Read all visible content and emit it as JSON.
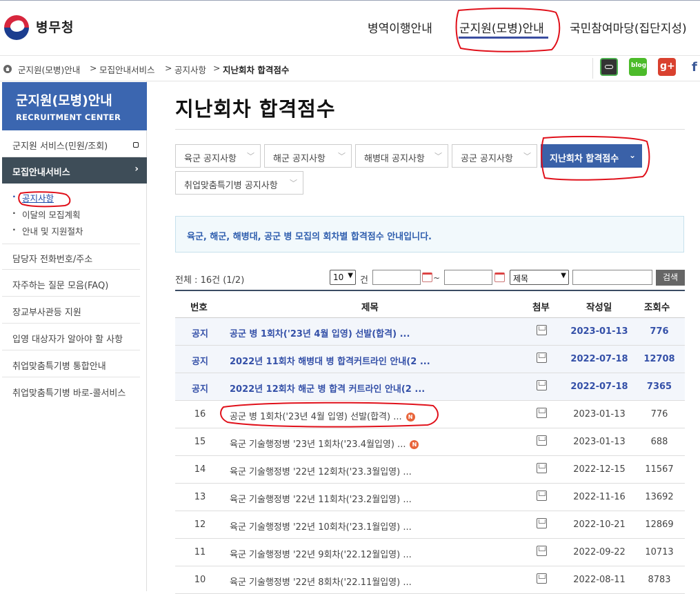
{
  "header": {
    "logo_text": "병무청",
    "nav": [
      "병역이행안내",
      "군지원(모병)안내",
      "국민참여마당(집단지성)"
    ]
  },
  "breadcrumb": [
    "군지원(모병)안내",
    "모집안내서비스",
    "공지사항",
    "지난회차 합격점수"
  ],
  "breadcrumb_sep": ">",
  "share": {
    "icons": [
      "band-icon",
      "blog-icon",
      "google-plus-icon",
      "facebook-icon"
    ],
    "blog_label": "blog",
    "gplus_label": "g+",
    "fb_label": "f"
  },
  "sidebar": {
    "title": "군지원(모병)안내",
    "subtitle": "RECRUITMENT CENTER",
    "items": [
      "군지원 서비스(민원/조회)",
      "모집안내서비스",
      "담당자 전화번호/주소",
      "자주하는 질문 모음(FAQ)",
      "장교부사관등 지원",
      "입영 대상자가 알아야 할 사항",
      "취업맞춤특기병 통합안내",
      "취업맞춤특기병 바로-콜서비스"
    ],
    "active_arrow": "›",
    "sub_items": [
      "공지사항",
      "이달의 모집계획",
      "안내 및 지원절차"
    ]
  },
  "page": {
    "title": "지난회차 합격점수",
    "tabs": [
      "육군 공지사항",
      "해군 공지사항",
      "해병대 공지사항",
      "공군 공지사항",
      "지난회차 합격점수",
      "취업맞춤특기병 공지사항"
    ],
    "notice": "육군, 해군, 해병대, 공군 병 모집의 회차별 합격점수 안내입니다."
  },
  "search": {
    "total": "전체 : 16건 (1/2)",
    "per_page": "10",
    "unit": "건",
    "tilde": "~",
    "field": "제목",
    "button": "검색"
  },
  "table": {
    "headers": [
      "번호",
      "제목",
      "첨부",
      "작성일",
      "조회수"
    ],
    "new_badge": "N",
    "rows": [
      {
        "no": "공지",
        "title": "공군 병 1회차('23년 4월 입영) 선발(합격) ...",
        "date": "2023-01-13",
        "views": "776",
        "notice": true
      },
      {
        "no": "공지",
        "title": "2022년 11회차 해병대 병 합격커트라인 안내(2 ...",
        "date": "2022-07-18",
        "views": "12708",
        "notice": true
      },
      {
        "no": "공지",
        "title": "2022년 12회차 해군 병 합격 커트라인 안내(2 ...",
        "date": "2022-07-18",
        "views": "7365",
        "notice": true
      },
      {
        "no": "16",
        "title": "공군 병 1회차('23년 4월 입영) 선발(합격) ...",
        "date": "2023-01-13",
        "views": "776",
        "new": true
      },
      {
        "no": "15",
        "title": "육군 기술행정병 '23년 1회차('23.4월입영) ...",
        "date": "2023-01-13",
        "views": "688",
        "new": true
      },
      {
        "no": "14",
        "title": "육군 기술행정병 '22년 12회차('23.3월입영) ...",
        "date": "2022-12-15",
        "views": "11567"
      },
      {
        "no": "13",
        "title": "육군 기술행정병 '22년 11회차('23.2월입영) ...",
        "date": "2022-11-16",
        "views": "13692"
      },
      {
        "no": "12",
        "title": "육군 기술행정병 '22년 10회차('23.1월입영) ...",
        "date": "2022-10-21",
        "views": "12869"
      },
      {
        "no": "11",
        "title": "육군 기술행정병 '22년 9회차('22.12월입영) ...",
        "date": "2022-09-22",
        "views": "10713"
      },
      {
        "no": "10",
        "title": "육군 기술행정병 '22년 8회차('22.11월입영) ...",
        "date": "2022-08-11",
        "views": "8783"
      }
    ]
  },
  "colors": {
    "accent": "#3a61a8",
    "sidebar_head": "#3b66b0",
    "sidebar_active": "#3e4d58",
    "notice_text": "#3450a8",
    "annotation": "#e0101a"
  }
}
